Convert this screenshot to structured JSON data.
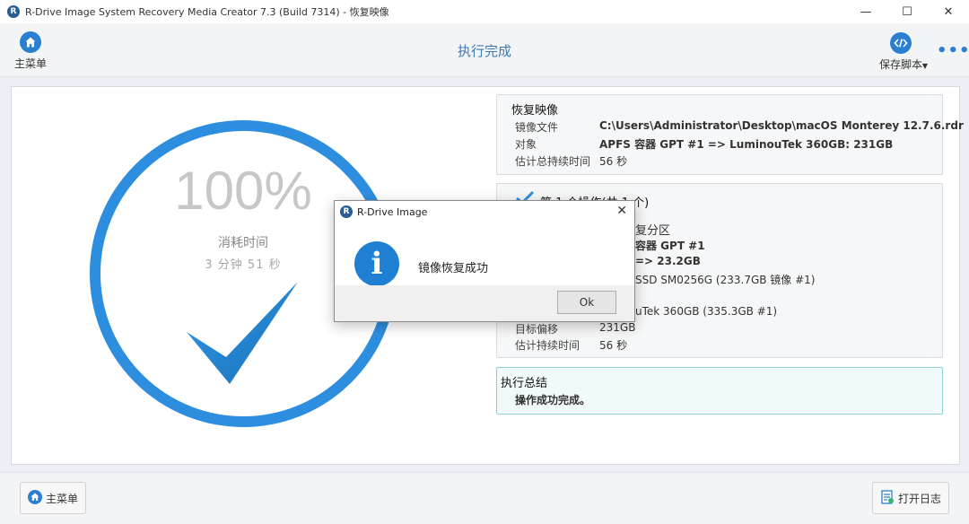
{
  "window": {
    "title": "R-Drive Image System Recovery Media Creator 7.3 (Build 7314) - 恢复映像",
    "logo_letter": "R",
    "controls": [
      "—",
      "☐",
      "✕"
    ]
  },
  "toolbar": {
    "home_label": "主菜单",
    "page_title": "执行完成",
    "save_script_label": "保存脚本",
    "more_label": "•••"
  },
  "progress": {
    "percent_text": "100%",
    "percent_value": 100,
    "elapsed_label": "消耗时间",
    "elapsed_value": "3 分钟 51 秒"
  },
  "restore_card": {
    "title": "恢复映像",
    "rows": [
      {
        "key": "镜像文件",
        "value": "C:\\Users\\Administrator\\Desktop\\macOS Monterey 12.7.6.rdr"
      },
      {
        "key": "对象",
        "value": "APFS 容器 GPT #1  => LuminouTek 360GB: 231GB"
      },
      {
        "key": "估计总持续时间",
        "value": "56 秒"
      }
    ]
  },
  "operation_card": {
    "title": "第 1 个操作(共 1 个)",
    "rows": [
      {
        "key": "",
        "value": "复分区"
      },
      {
        "key": "",
        "value": "容器 GPT #1"
      },
      {
        "key": "",
        "value": "=> 23.2GB"
      },
      {
        "key": "",
        "value": "SSD SM0256G (233.7GB 镜像 #1)"
      },
      {
        "key": "",
        "value": "uTek 360GB (335.3GB #1)"
      },
      {
        "key": "目标偏移",
        "value": "231GB"
      },
      {
        "key": "估计持续时间",
        "value": "56 秒"
      }
    ]
  },
  "summary_card": {
    "title": "执行总结",
    "text": "操作成功完成。"
  },
  "dialog": {
    "title": "R-Drive Image",
    "close": "✕",
    "message": "镜像恢复成功",
    "ok_label": "Ok",
    "info_glyph": "i"
  },
  "bottom": {
    "home_label": "主菜单",
    "open_log_label": "打开日志"
  },
  "colors": {
    "accent": "#2d8ee0",
    "title_blue": "#3b7bb6",
    "summary_border": "#8ed0d6"
  }
}
